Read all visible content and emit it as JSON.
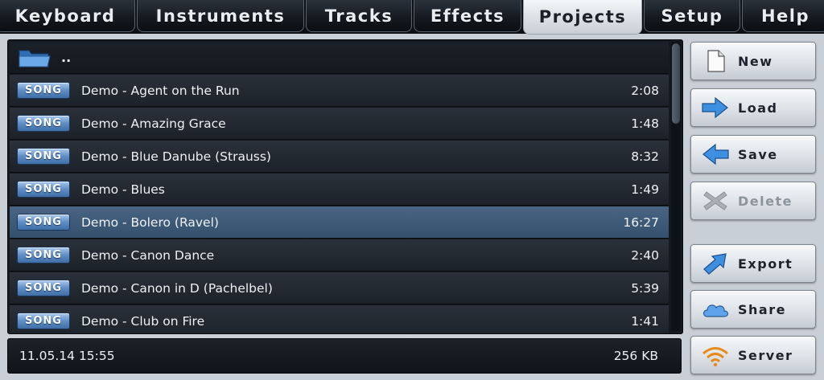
{
  "tabs": [
    {
      "label": "Keyboard",
      "active": false
    },
    {
      "label": "Instruments",
      "active": false
    },
    {
      "label": "Tracks",
      "active": false
    },
    {
      "label": "Effects",
      "active": false
    },
    {
      "label": "Projects",
      "active": true
    },
    {
      "label": "Setup",
      "active": false
    },
    {
      "label": "Help",
      "active": false
    }
  ],
  "file_list": {
    "parent_label": "..",
    "badge_label": "SONG",
    "items": [
      {
        "name": "Demo - Agent on the Run",
        "duration": "2:08"
      },
      {
        "name": "Demo - Amazing Grace",
        "duration": "1:48"
      },
      {
        "name": "Demo - Blue Danube (Strauss)",
        "duration": "8:32"
      },
      {
        "name": "Demo - Blues",
        "duration": "1:49"
      },
      {
        "name": "Demo - Bolero (Ravel)",
        "duration": "16:27",
        "selected": true
      },
      {
        "name": "Demo - Canon Dance",
        "duration": "2:40"
      },
      {
        "name": "Demo - Canon in D (Pachelbel)",
        "duration": "5:39"
      },
      {
        "name": "Demo - Club on Fire",
        "duration": "1:41"
      }
    ]
  },
  "status": {
    "datetime": "11.05.14 15:55",
    "size": "256 KB"
  },
  "actions": {
    "new": {
      "label": "New",
      "icon": "new-document-icon"
    },
    "load": {
      "label": "Load",
      "icon": "arrow-right-icon"
    },
    "save": {
      "label": "Save",
      "icon": "arrow-left-icon"
    },
    "delete": {
      "label": "Delete",
      "icon": "x-icon",
      "disabled": true
    },
    "export": {
      "label": "Export",
      "icon": "arrow-up-right-icon"
    },
    "share": {
      "label": "Share",
      "icon": "cloud-icon"
    },
    "server": {
      "label": "Server",
      "icon": "wifi-icon"
    }
  },
  "colors": {
    "accent_blue": "#3f8fe0",
    "selected_row": "#3f5a78",
    "wifi_orange": "#e88a1a"
  }
}
